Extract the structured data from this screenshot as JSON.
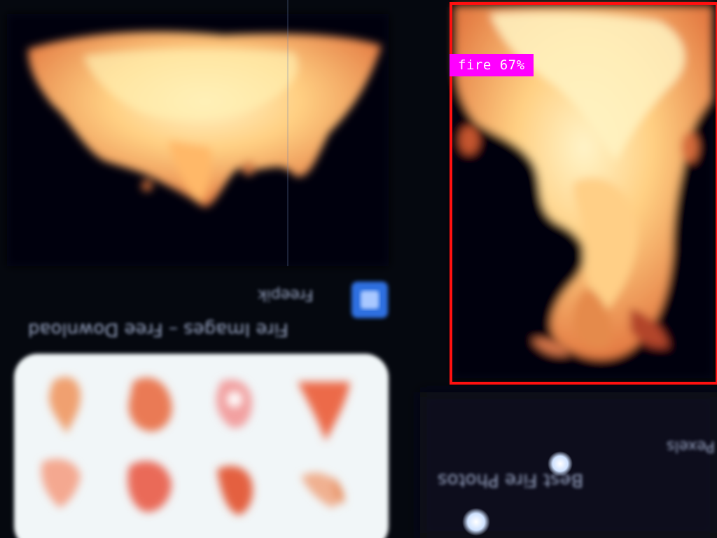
{
  "photo": {
    "description_colors": {
      "background": "#05080f",
      "flame_light": "#ffe9a0",
      "flame_mid": "#ffb060",
      "flame_deep": "#e0603a",
      "card": "#f2f6f8"
    }
  },
  "detection": {
    "label": "fire 67%",
    "box_color": "#ff1010",
    "label_background": "#ff00ff"
  },
  "blurred_screen_text": {
    "line1": "Fire Images – Free Download",
    "line2": "Freepik",
    "line3": "Best Fire Photos",
    "line4": "Pexels"
  }
}
